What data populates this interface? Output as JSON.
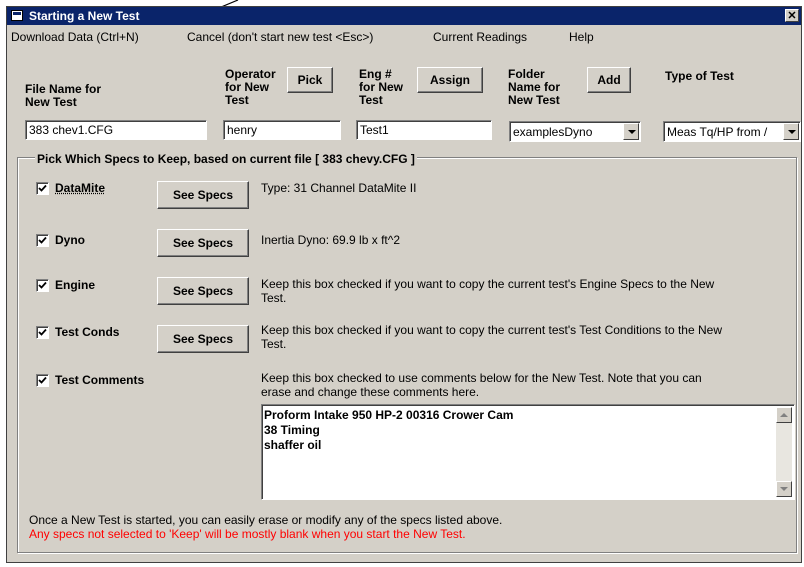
{
  "window": {
    "title": "Starting a New Test",
    "close_label": "✕"
  },
  "menu": [
    "Download Data (Ctrl+N)",
    "Cancel (don't start new test <Esc>)",
    "Current Readings",
    "Help"
  ],
  "fields": {
    "file_name": {
      "label_line1": "File Name for",
      "label_line2": "New Test",
      "value": "383 chev1.CFG"
    },
    "operator": {
      "label_line1": "Operator",
      "label_line2": "for New",
      "label_line3": "Test",
      "button": "Pick",
      "value": "henry"
    },
    "eng_num": {
      "label_line1": "Eng #",
      "label_line2": "for New",
      "label_line3": "Test",
      "button": "Assign",
      "value": "Test1"
    },
    "folder": {
      "label_line1": "Folder",
      "label_line2": "Name for",
      "label_line3": "New Test",
      "button": "Add",
      "value": "examplesDyno"
    },
    "test_type": {
      "label": "Type of Test",
      "value": "Meas Tq/HP from /"
    }
  },
  "group_title": "Pick Which Specs to Keep, based on current file [ 383 chevy.CFG ]",
  "specs": [
    {
      "label": "DataMite",
      "checked": true,
      "button": "See Specs",
      "desc_line1": "Type: 31 Channel DataMite II",
      "desc_line2": ""
    },
    {
      "label": "Dyno",
      "checked": true,
      "button": "See Specs",
      "desc_line1": "Inertia Dyno:  69.9 lb x ft^2",
      "desc_line2": ""
    },
    {
      "label": "Engine",
      "checked": true,
      "button": "See Specs",
      "desc_line1": "Keep this box checked if you want to copy the current test's Engine Specs to the New",
      "desc_line2": "Test."
    },
    {
      "label": "Test Conds",
      "checked": true,
      "button": "See Specs",
      "desc_line1": "Keep this box checked if you want to copy the current test's Test Conditions to the New",
      "desc_line2": "Test."
    }
  ],
  "comments": {
    "label": "Test Comments",
    "checked": true,
    "desc_line1": "Keep this box checked to use comments below for the New Test.  Note that you can",
    "desc_line2": "erase and change these comments here.",
    "lines": [
      "Proform Intake 950 HP-2 00316 Crower Cam",
      "38 Timing",
      "shaffer oil"
    ]
  },
  "footer": {
    "note": "Once a New Test is started, you can easily erase or modify any of the specs listed above.",
    "warning": "Any specs not selected to 'Keep' will be mostly blank when you start the New Test."
  },
  "colors": {
    "title_bar": "#0a246a",
    "face": "#d4d0c8",
    "warning": "#ff0000"
  }
}
